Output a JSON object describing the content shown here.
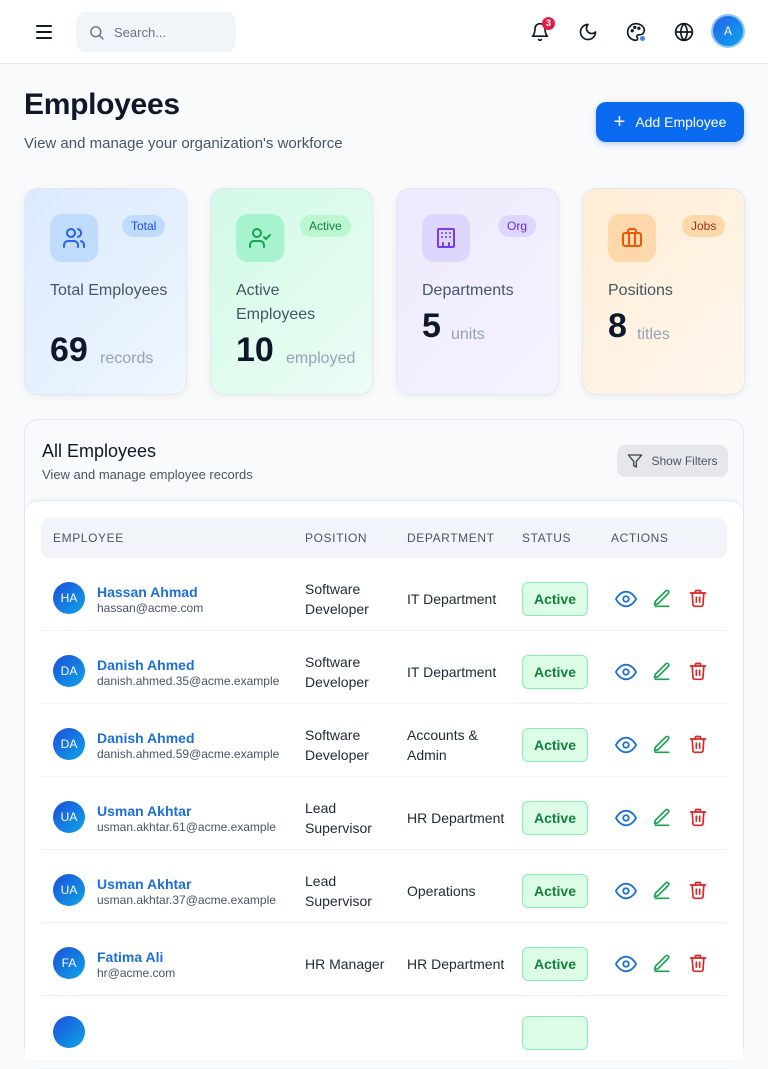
{
  "topbar": {
    "search_placeholder": "Search...",
    "notification_count": "3",
    "avatar_initial": "A"
  },
  "header": {
    "title": "Employees",
    "subtitle": "View and manage your organization's workforce",
    "add_button": "Add Employee"
  },
  "stats": [
    {
      "badge": "Total",
      "label": "Total Employees",
      "value": "69",
      "unit": "records",
      "icon": "users-icon",
      "accent": "#2563eb"
    },
    {
      "badge": "Active",
      "label": "Active Employees",
      "value": "10",
      "unit": "employed",
      "icon": "user-check-icon",
      "accent": "#16a34a"
    },
    {
      "badge": "Org",
      "label": "Departments",
      "value": "5",
      "unit": "units",
      "icon": "building-icon",
      "accent": "#7c3aed"
    },
    {
      "badge": "Jobs",
      "label": "Positions",
      "value": "8",
      "unit": "titles",
      "icon": "briefcase-icon",
      "accent": "#ea580c"
    }
  ],
  "panel": {
    "title": "All Employees",
    "subtitle": "View and manage employee records",
    "filter_button": "Show Filters"
  },
  "table": {
    "columns": [
      "EMPLOYEE",
      "POSITION",
      "DEPARTMENT",
      "STATUS",
      "ACTIONS"
    ],
    "rows": [
      {
        "initials": "HA",
        "name": "Hassan Ahmad",
        "email": "hassan@acme.com",
        "position": "Software Developer",
        "department": "IT Department",
        "status": "Active"
      },
      {
        "initials": "DA",
        "name": "Danish Ahmed",
        "email": "danish.ahmed.35@acme.example",
        "position": "Software Developer",
        "department": "IT Department",
        "status": "Active"
      },
      {
        "initials": "DA",
        "name": "Danish Ahmed",
        "email": "danish.ahmed.59@acme.example",
        "position": "Software Developer",
        "department": "Accounts & Admin",
        "status": "Active"
      },
      {
        "initials": "UA",
        "name": "Usman Akhtar",
        "email": "usman.akhtar.61@acme.example",
        "position": "Lead Supervisor",
        "department": "HR Department",
        "status": "Active"
      },
      {
        "initials": "UA",
        "name": "Usman Akhtar",
        "email": "usman.akhtar.37@acme.example",
        "position": "Lead Supervisor",
        "department": "Operations",
        "status": "Active"
      },
      {
        "initials": "FA",
        "name": "Fatima Ali",
        "email": "hr@acme.com",
        "position": "HR Manager",
        "department": "HR Department",
        "status": "Active"
      }
    ]
  }
}
